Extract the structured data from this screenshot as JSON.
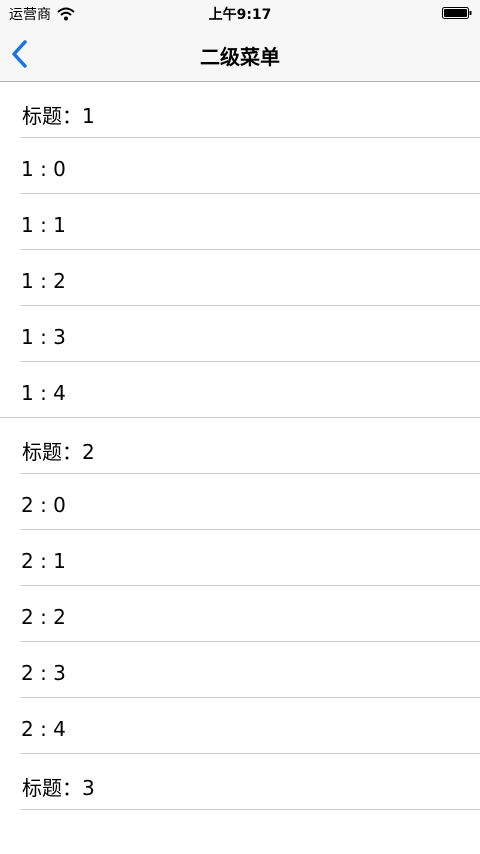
{
  "status_bar": {
    "carrier": "运营商",
    "time": "上午9:17"
  },
  "nav": {
    "title": "二级菜单"
  },
  "sections": [
    {
      "header": "标题：1",
      "rows": [
        "1 : 0",
        "1 : 1",
        "1 : 2",
        "1 : 3",
        "1 : 4"
      ]
    },
    {
      "header": "标题：2",
      "rows": [
        "2 : 0",
        "2 : 1",
        "2 : 2",
        "2 : 3",
        "2 : 4"
      ]
    },
    {
      "header": "标题：3",
      "rows": []
    }
  ],
  "colors": {
    "accent": "#1a73e8",
    "separator": "#cfcfcf",
    "bar_background": "#f7f7f7"
  }
}
